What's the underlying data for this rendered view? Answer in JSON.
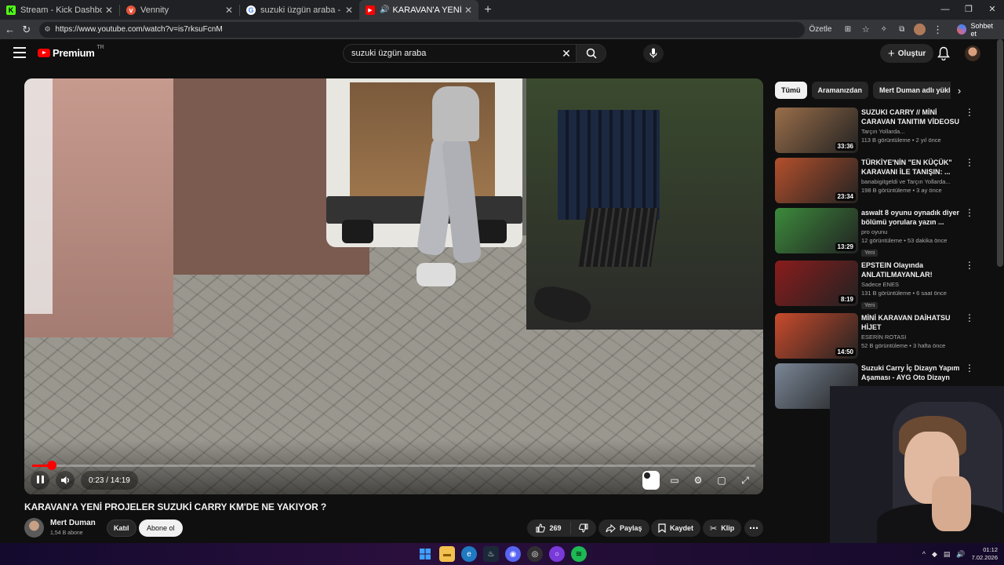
{
  "browser": {
    "tabs": [
      {
        "title": "Stream - Kick Dashboard",
        "icon": "kick-icon",
        "color": "#53fc18"
      },
      {
        "title": "Vennity",
        "icon": "vennity-icon",
        "color": "#e8553c"
      },
      {
        "title": "suzuki üzgün araba - Google'da A",
        "icon": "google-icon",
        "color": "#ffffff"
      },
      {
        "title": "KARAVAN'A YENİ PROJELER S",
        "icon": "youtube-icon",
        "color": "#ff0000",
        "active": true
      }
    ],
    "url": "https://www.youtube.com/watch?v=is7rksuFcnM",
    "ozetle_label": "Özetle",
    "chat_label": "Sohbet et"
  },
  "youtube": {
    "logo_text": "Premium",
    "country_code": "TR",
    "search_query": "suzuki üzgün araba",
    "create_label": "Oluştur"
  },
  "player": {
    "time_current": "0:23",
    "time_total": "14:19",
    "time_display": "0:23 / 14:19",
    "progress": 0.027
  },
  "video": {
    "title": "KARAVAN'A YENİ PROJELER SUZUKİ CARRY KM'DE NE YAKIYOR ?",
    "channel": "Mert Duman",
    "subscribers": "1,54 B abone",
    "join_label": "Katıl",
    "subscribe_label": "Abone ol",
    "likes": "269",
    "share_label": "Paylaş",
    "save_label": "Kaydet",
    "clip_label": "Klip"
  },
  "sidebar": {
    "chips": [
      "Tümü",
      "Aramanızdan",
      "Mert Duman adlı yükley"
    ],
    "recommendations": [
      {
        "title": "SUZUKI CARRY // MİNİ CARAVAN TANITIM VİDEOSU ...",
        "channel": "Tarçın Yollarda...",
        "stats": "113 B görüntüleme • 2 yıl önce",
        "duration": "33:36",
        "thumb": "#9a6e4a",
        "badge": ""
      },
      {
        "title": "TÜRKİYE'NİN \"EN KÜÇÜK\" KARAVANI İLE TANIŞIN: ...",
        "channel": "banabigitgeldi ve Tarçın Yollarda...",
        "stats": "198 B görüntüleme • 3 ay önce",
        "duration": "23:34",
        "thumb": "#b4502c",
        "badge": ""
      },
      {
        "title": "aswalt 8 oyunu oynadık diyer bölümü yorulara yazın ...",
        "channel": "pro oyunu",
        "stats": "12 görüntüleme • 53 dakika önce",
        "duration": "13:29",
        "thumb": "#3c8a3c",
        "badge": "Yeni"
      },
      {
        "title": "EPSTEIN Olayında ANLATILMAYANLAR!",
        "channel": "Sadece ENES",
        "stats": "131 B görüntüleme • 6 saat önce",
        "duration": "8:19",
        "thumb": "#8a1c1c",
        "badge": "Yeni"
      },
      {
        "title": "MİNİ KARAVAN DAİHATSU HİJET",
        "channel": "ESERİN ROTASI",
        "stats": "52 B görüntüleme • 3 hafta önce",
        "duration": "14:50",
        "thumb": "#c94b2c",
        "badge": ""
      },
      {
        "title": "Suzuki Carry İç Dizayn Yapım Aşaması - AYG Oto Dizayn",
        "channel": "",
        "stats": "",
        "duration": "",
        "thumb": "#7a8696",
        "badge": ""
      }
    ]
  },
  "taskbar": {
    "time": "01:12",
    "date": "7.02.2026"
  }
}
